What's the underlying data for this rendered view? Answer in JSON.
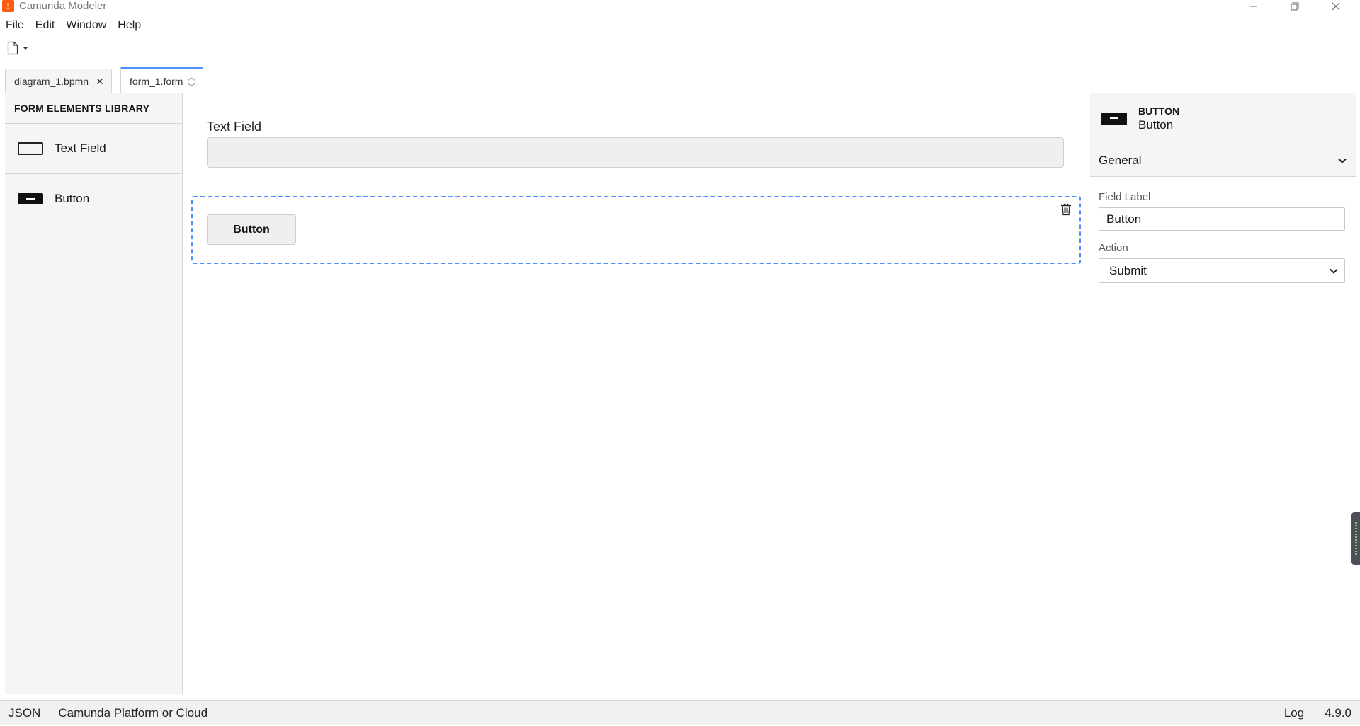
{
  "window": {
    "title": "Camunda Modeler",
    "logo_text": "!",
    "controls": [
      "minimize",
      "restore",
      "close"
    ]
  },
  "menu": {
    "items": [
      "File",
      "Edit",
      "Window",
      "Help"
    ]
  },
  "toolbar": {
    "new_file_icon": "new-file-icon",
    "dropdown_icon": "caret-down-icon"
  },
  "tabs": [
    {
      "label": "diagram_1.bpmn",
      "active": false,
      "indicator": "close"
    },
    {
      "label": "form_1.form",
      "active": true,
      "indicator": "unsaved"
    }
  ],
  "palette": {
    "header": "FORM ELEMENTS LIBRARY",
    "items": [
      {
        "label": "Text Field",
        "icon": "textfield-icon"
      },
      {
        "label": "Button",
        "icon": "button-icon"
      }
    ]
  },
  "canvas": {
    "text_field_label": "Text Field",
    "text_field_value": "",
    "button_label": "Button",
    "selection_color": "#4d90ff"
  },
  "properties": {
    "element_type": "BUTTON",
    "element_name": "Button",
    "group_title": "General",
    "field_label_title": "Field Label",
    "field_label_value": "Button",
    "action_title": "Action",
    "action_value": "Submit"
  },
  "statusbar": {
    "format": "JSON",
    "platform": "Camunda Platform or Cloud",
    "log": "Log",
    "version": "4.9.0"
  },
  "colors": {
    "accent": "#4d90ff",
    "brand": "#fc5d0d"
  }
}
